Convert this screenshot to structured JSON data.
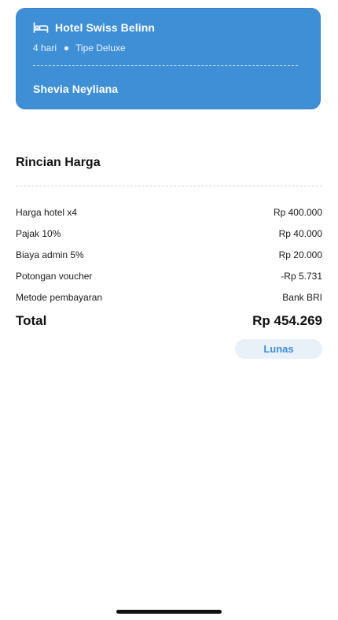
{
  "booking": {
    "hotel_name": "Hotel Swiss Belinn",
    "duration": "4 hari",
    "room_type": "Tipe Deluxe",
    "guest_name": "Shevia Neyliana",
    "icon": "bed-icon"
  },
  "price_details": {
    "title": "Rincian Harga",
    "rows": [
      {
        "label": "Harga hotel x4",
        "value": "Rp 400.000"
      },
      {
        "label": "Pajak 10%",
        "value": "Rp 40.000"
      },
      {
        "label": "Biaya admin 5%",
        "value": "Rp 20.000"
      },
      {
        "label": "Potongan voucher",
        "value": "-Rp 5.731"
      },
      {
        "label": "Metode pembayaran",
        "value": "Bank BRI"
      }
    ],
    "total_label": "Total",
    "total_value": "Rp 454.269",
    "status": "Lunas"
  },
  "colors": {
    "accent": "#3f8fd7",
    "status_bg": "#e8f0f8"
  }
}
